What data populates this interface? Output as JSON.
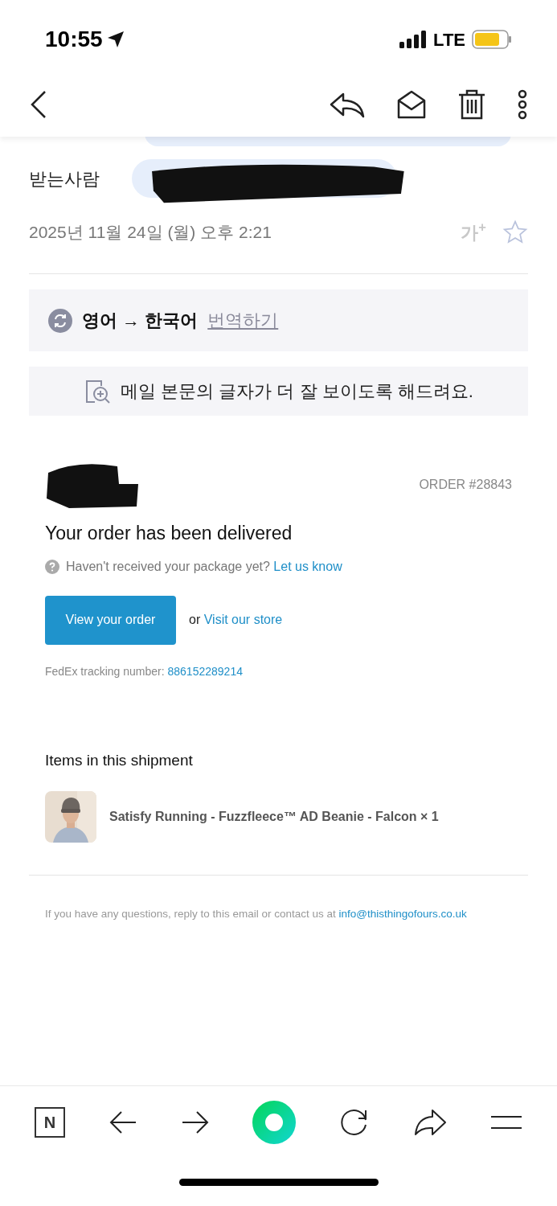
{
  "status_bar": {
    "time": "10:55",
    "network": "LTE"
  },
  "recipient": {
    "label": "받는사람"
  },
  "date": "2025년 11월 24일 (월) 오후 2:21",
  "font_size_button": "가$^{+}$",
  "starred": false,
  "translate": {
    "from_to": "영어 → 한국어",
    "action": "번역하기"
  },
  "readability_banner": "메일 본문의 글자가 더 잘 보이도록 해드려요.",
  "email": {
    "order_number": "ORDER #28843",
    "heading": "Your order has been delivered",
    "help_text": "Haven't received your package yet?",
    "help_link": "Let us know",
    "primary_button": "View your order",
    "or_text": "or",
    "store_link": "Visit our store",
    "tracking_label": "FedEx tracking number:",
    "tracking_number": "886152289214",
    "items_heading": "Items in this shipment",
    "items": [
      {
        "name": "Satisfy Running - Fuzzfleece™ AD Beanie - Falcon × 1"
      }
    ],
    "footer_text": "If you have any questions, reply to this email or contact us at",
    "footer_email": "info@thisthingofours.co.uk"
  },
  "bottom_bar": {
    "home_label": "N"
  }
}
